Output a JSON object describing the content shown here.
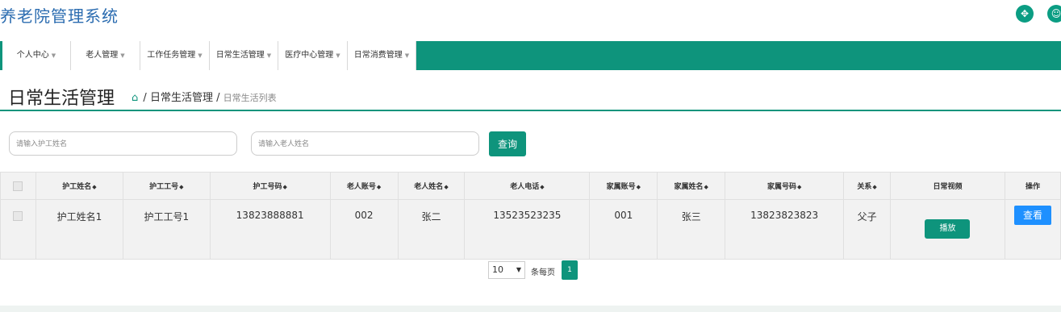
{
  "app": {
    "title": "养老院管理系统"
  },
  "top_icons": [
    "expand-icon",
    "user-icon"
  ],
  "nav": [
    {
      "label": "个人中心"
    },
    {
      "label": "老人管理"
    },
    {
      "label": "工作任务管理"
    },
    {
      "label": "日常生活管理"
    },
    {
      "label": "医疗中心管理"
    },
    {
      "label": "日常消费管理"
    }
  ],
  "page": {
    "title": "日常生活管理",
    "breadcrumb": {
      "sep": "/",
      "section": "日常生活管理",
      "current": "日常生活列表"
    }
  },
  "search": {
    "nurse_name_placeholder": "请输入护工姓名",
    "elder_name_placeholder": "请输入老人姓名",
    "query_label": "查询"
  },
  "table": {
    "columns": [
      "护工姓名",
      "护工工号",
      "护工号码",
      "老人账号",
      "老人姓名",
      "老人电话",
      "家属账号",
      "家属姓名",
      "家属号码",
      "关系",
      "日常视频",
      "操作"
    ],
    "sortable_mark": "◆",
    "rows": [
      {
        "nurse_name": "护工姓名1",
        "nurse_id": "护工工号1",
        "nurse_phone": "13823888881",
        "elder_account": "002",
        "elder_name": "张二",
        "elder_phone": "13523523235",
        "family_account": "001",
        "family_name": "张三",
        "family_phone": "13823823823",
        "relation": "父子",
        "video_button": "播放",
        "action_button": "查看"
      }
    ]
  },
  "pagination": {
    "page_size": "10",
    "per_page_label": "条每页",
    "current_page": "1"
  },
  "colors": {
    "primary": "#0e947c",
    "view_button": "#1e90ff",
    "title_blue": "#2b6cb0"
  }
}
